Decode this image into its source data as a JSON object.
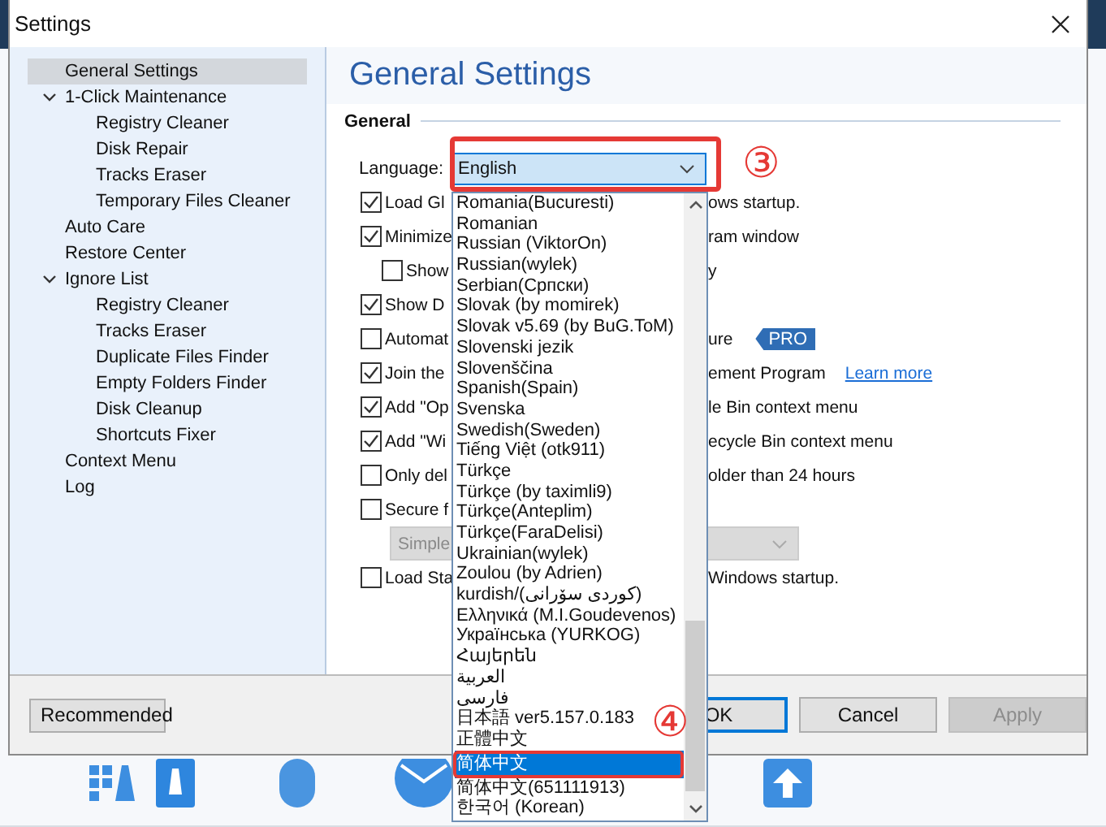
{
  "window": {
    "title": "Settings"
  },
  "sidebar": {
    "items": [
      {
        "label": "General Settings",
        "selected": true
      },
      {
        "label": "1-Click Maintenance",
        "selected": false,
        "expanded": true,
        "children": [
          {
            "label": "Registry Cleaner",
            "selected": false
          },
          {
            "label": "Disk Repair",
            "selected": false
          },
          {
            "label": "Tracks Eraser",
            "selected": false
          },
          {
            "label": "Temporary Files Cleaner",
            "selected": false
          }
        ]
      },
      {
        "label": "Auto Care",
        "selected": false
      },
      {
        "label": "Restore Center",
        "selected": false
      },
      {
        "label": "Ignore List",
        "selected": false,
        "expanded": true,
        "children": [
          {
            "label": "Registry Cleaner",
            "selected": false
          },
          {
            "label": "Tracks Eraser",
            "selected": false
          },
          {
            "label": "Duplicate Files Finder",
            "selected": false
          },
          {
            "label": "Empty Folders Finder",
            "selected": false
          },
          {
            "label": "Disk Cleanup",
            "selected": false
          },
          {
            "label": "Shortcuts Fixer",
            "selected": false
          }
        ]
      },
      {
        "label": "Context Menu",
        "selected": false
      },
      {
        "label": "Log",
        "selected": false
      }
    ]
  },
  "panel": {
    "title": "General Settings",
    "section": "General"
  },
  "language": {
    "label": "Language:",
    "value": "English"
  },
  "options": [
    {
      "start": "Load Gl",
      "end": "ows startup.",
      "checked": true
    },
    {
      "start": "Minimize",
      "end": "ram window",
      "checked": true,
      "children": [
        {
          "start": "Show",
          "end": "y",
          "checked": false
        }
      ]
    },
    {
      "start": "Show D",
      "checked": true
    },
    {
      "start": "Automat",
      "end": "ure",
      "badge": "PRO",
      "checked": false
    },
    {
      "start": "Join the",
      "end": "ement Program",
      "link": "Learn more",
      "checked": true
    },
    {
      "start": "Add \"Op",
      "end": "le Bin context menu",
      "checked": true
    },
    {
      "start": "Add \"Wi",
      "end": "ecycle Bin context menu",
      "checked": true
    },
    {
      "start": "Only del",
      "end": "older than 24 hours",
      "checked": false
    },
    {
      "start": "Secure f",
      "checked": false,
      "select": {
        "value": "Simple",
        "disabled": true
      }
    },
    {
      "start": "Load Sta",
      "end": "Windows startup.",
      "checked": false
    }
  ],
  "language_list": {
    "items": [
      {
        "label": "Romania(Bucuresti)",
        "selected": false
      },
      {
        "label": "Romanian",
        "selected": false
      },
      {
        "label": "Russian (ViktorOn)",
        "selected": false
      },
      {
        "label": "Russian(wylek)",
        "selected": false
      },
      {
        "label": "Serbian(Српски)",
        "selected": false
      },
      {
        "label": "Slovak (by momirek)",
        "selected": false
      },
      {
        "label": "Slovak v5.69 (by BuG.ToM)",
        "selected": false
      },
      {
        "label": "Slovenski jezik",
        "selected": false
      },
      {
        "label": "Slovenščina",
        "selected": false
      },
      {
        "label": "Spanish(Spain)",
        "selected": false
      },
      {
        "label": "Svenska",
        "selected": false
      },
      {
        "label": "Swedish(Sweden)",
        "selected": false
      },
      {
        "label": "Tiếng Việt (otk911)",
        "selected": false
      },
      {
        "label": "Türkçe",
        "selected": false
      },
      {
        "label": "Türkçe (by taximli9)",
        "selected": false
      },
      {
        "label": "Türkçe(Anteplim)",
        "selected": false
      },
      {
        "label": "Türkçe(FaraDelisi)",
        "selected": false
      },
      {
        "label": "Ukrainian(wylek)",
        "selected": false
      },
      {
        "label": "Zoulou (by Adrien)",
        "selected": false
      },
      {
        "label": "kurdish/(کوردی سۆرانی)",
        "selected": false
      },
      {
        "label": "Ελληνικά (M.I.Goudevenos)",
        "selected": false
      },
      {
        "label": "Українська (YURKOG)",
        "selected": false
      },
      {
        "label": "Հայերեն",
        "selected": false
      },
      {
        "label": "العربية",
        "selected": false
      },
      {
        "label": "فارسی",
        "selected": false
      },
      {
        "label": "日本語 ver5.157.0.183",
        "selected": false
      },
      {
        "label": "正體中文",
        "selected": false
      },
      {
        "label": "简体中文",
        "selected": true
      },
      {
        "label": "简体中文(651111913)",
        "selected": false
      },
      {
        "label": "한국어 (Korean)",
        "selected": false
      }
    ]
  },
  "annotations": [
    {
      "label": "③"
    },
    {
      "label": "④"
    }
  ],
  "buttons": [
    {
      "label": "Recommended",
      "kind": "left",
      "disabled": false,
      "default": false
    },
    {
      "label": "OK",
      "kind": "right",
      "disabled": false,
      "default": true
    },
    {
      "label": "Cancel",
      "kind": "right",
      "disabled": false,
      "default": false
    },
    {
      "label": "Apply",
      "kind": "right",
      "disabled": true,
      "default": false
    }
  ]
}
